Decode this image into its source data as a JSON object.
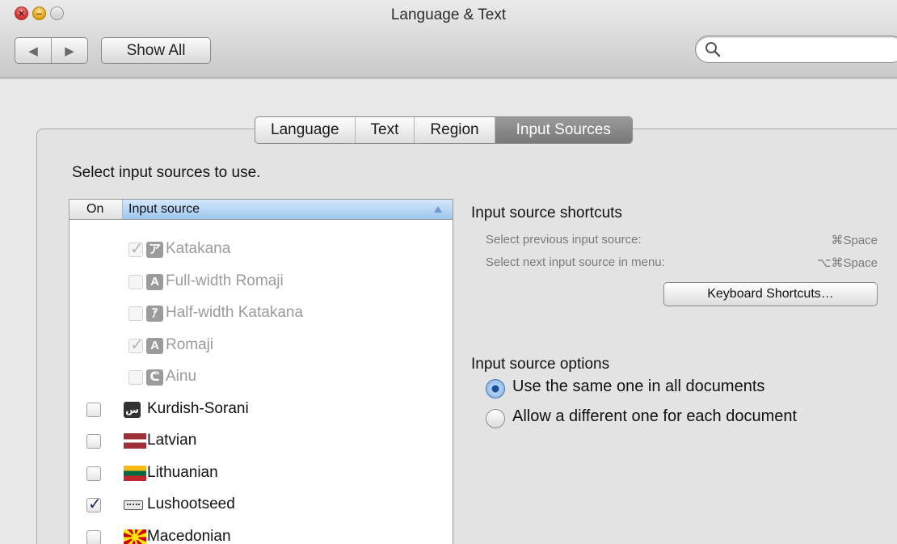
{
  "window": {
    "title": "Language & Text"
  },
  "toolbar": {
    "back_glyph": "◀",
    "forward_glyph": "▶",
    "show_all_label": "Show All",
    "search_placeholder": ""
  },
  "tabs": [
    {
      "label": "Language",
      "selected": false
    },
    {
      "label": "Text",
      "selected": false
    },
    {
      "label": "Region",
      "selected": false
    },
    {
      "label": "Input Sources",
      "selected": true
    }
  ],
  "instructions": "Select input sources to use.",
  "list": {
    "header_on": "On",
    "header_source": "Input source",
    "rows": [
      {
        "label": "Katakana",
        "checked": true,
        "enabled": false,
        "indent": true,
        "icon_glyph": "ア",
        "icon_name": "katakana-icon"
      },
      {
        "label": "Full-width Romaji",
        "checked": false,
        "enabled": false,
        "indent": true,
        "icon_glyph": "A",
        "icon_name": "fullwidth-romaji-icon"
      },
      {
        "label": "Half-width Katakana",
        "checked": false,
        "enabled": false,
        "indent": true,
        "icon_glyph": "ｱ",
        "icon_name": "halfwidth-katakana-icon"
      },
      {
        "label": "Romaji",
        "checked": true,
        "enabled": false,
        "indent": true,
        "icon_glyph": "A",
        "icon_name": "romaji-icon"
      },
      {
        "label": "Ainu",
        "checked": false,
        "enabled": false,
        "indent": true,
        "icon_glyph": "ᕦ",
        "icon_name": "ainu-icon"
      },
      {
        "label": "Kurdish-Sorani",
        "checked": false,
        "enabled": true,
        "indent": false,
        "icon_glyph": "س",
        "icon_name": "kurdish-sorani-icon"
      },
      {
        "label": "Latvian",
        "checked": false,
        "enabled": true,
        "indent": false,
        "icon_name": "latvia-flag-icon"
      },
      {
        "label": "Lithuanian",
        "checked": false,
        "enabled": true,
        "indent": false,
        "icon_name": "lithuania-flag-icon"
      },
      {
        "label": "Lushootseed",
        "checked": true,
        "enabled": true,
        "indent": false,
        "icon_name": "keyboard-icon"
      },
      {
        "label": "Macedonian",
        "checked": false,
        "enabled": true,
        "indent": false,
        "icon_name": "macedonia-flag-icon"
      }
    ]
  },
  "shortcuts": {
    "title": "Input source shortcuts",
    "previous_label": "Select previous input source:",
    "previous_value": "⌘Space",
    "next_label": "Select next input source in menu:",
    "next_value": "⌥⌘Space",
    "button_label": "Keyboard Shortcuts…"
  },
  "options": {
    "title": "Input source options",
    "same_label": "Use the same one in all documents",
    "different_label": "Allow a different one for each document",
    "selected": "same"
  },
  "colors": {
    "selected_tab": "#8a8a8a",
    "header_highlight": "#b9d7f6",
    "checkmark": "#1b2a6a",
    "radio_selected": "#1a4d9c"
  }
}
